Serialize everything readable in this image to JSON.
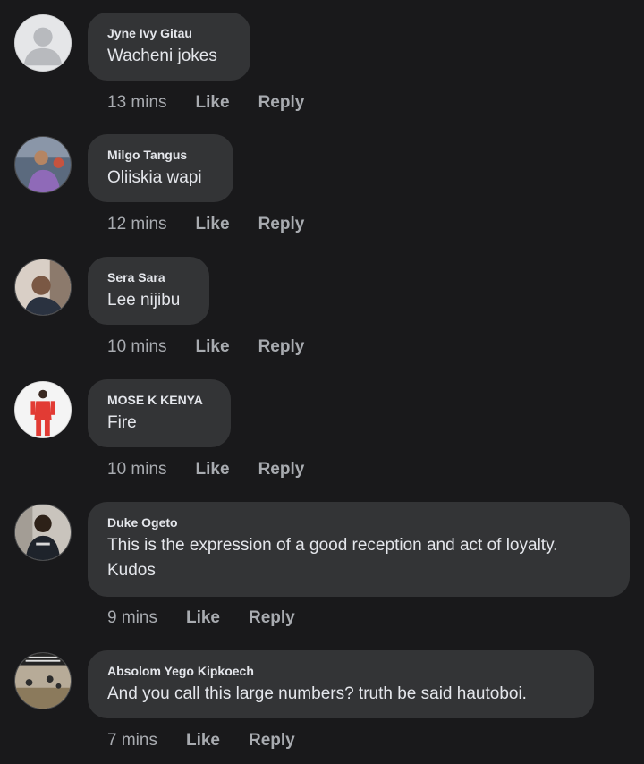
{
  "colors": {
    "background": "#19191b",
    "bubble": "#333436",
    "text": "#e4e6eb",
    "meta": "#a8abb0"
  },
  "actions": {
    "like": "Like",
    "reply": "Reply"
  },
  "comments": [
    {
      "author": "Jyne Ivy Gitau",
      "text": "Wacheni jokes",
      "time": "13 mins",
      "avatar": "default-profile-avatar"
    },
    {
      "author": "Milgo Tangus",
      "text": "Oliiskia wapi",
      "time": "12 mins",
      "avatar": "user-photo-avatar"
    },
    {
      "author": "Sera Sara",
      "text": "Lee nijibu",
      "time": "10 mins",
      "avatar": "user-photo-avatar"
    },
    {
      "author": "MOSE K KENYA",
      "text": "Fire",
      "time": "10 mins",
      "avatar": "user-photo-avatar"
    },
    {
      "author": "Duke Ogeto",
      "text": "This is the expression of a good reception and act of loyalty. Kudos",
      "time": "9 mins",
      "avatar": "user-photo-avatar"
    },
    {
      "author": "Absolom Yego Kipkoech",
      "text": "And you call this large numbers? truth be said hautoboi.",
      "time": "7 mins",
      "avatar": "user-photo-avatar"
    }
  ]
}
